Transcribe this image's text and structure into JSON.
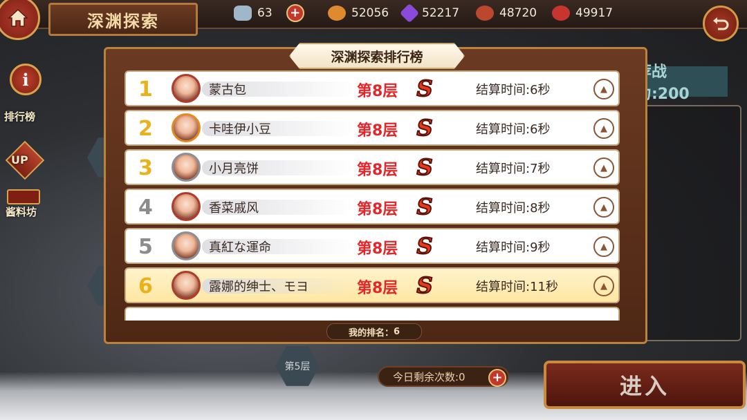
{
  "header": {
    "title": "深渊探索",
    "resources": [
      {
        "icon": "crystal-icon",
        "value": "63",
        "color": "#9fb7c9"
      },
      {
        "icon": "potion-icon",
        "value": "52056",
        "color": "#e08a2f"
      },
      {
        "icon": "gem-icon",
        "value": "52217",
        "color": "#8a4bd8"
      },
      {
        "icon": "meat-icon",
        "value": "48720",
        "color": "#b9482e"
      },
      {
        "icon": "pot-icon",
        "value": "49917",
        "color": "#c7362e"
      }
    ]
  },
  "left_menu": {
    "info": "i",
    "ranking": "排行榜",
    "up": "UP",
    "materials": "酱料坊"
  },
  "right": {
    "power": "荐战力:200",
    "remaining": "今日剩余次数:0",
    "enter": "进入"
  },
  "map": {
    "floor5": "第5层",
    "floor_partial": "第"
  },
  "leaderboard": {
    "title": "深渊探索排行榜",
    "my_rank_label": "我的排名：",
    "my_rank_value": "6",
    "rows": [
      {
        "rank": "1",
        "name": "蒙古包",
        "floor": "第8层",
        "grade": "S",
        "time": "结算时间:6秒",
        "rank_color": "#e8b21d",
        "avatar_border": "#b23a2a"
      },
      {
        "rank": "2",
        "name": "卡哇伊小豆",
        "floor": "第8层",
        "grade": "S",
        "time": "结算时间:6秒",
        "rank_color": "#e8b21d",
        "avatar_border": "#e38a1e"
      },
      {
        "rank": "3",
        "name": "小月亮饼",
        "floor": "第8层",
        "grade": "S",
        "time": "结算时间:7秒",
        "rank_color": "#e8b21d",
        "avatar_border": "#8b8f96"
      },
      {
        "rank": "4",
        "name": "香菜戚风",
        "floor": "第8层",
        "grade": "S",
        "time": "结算时间:8秒",
        "rank_color": "#8c8c8c",
        "avatar_border": "#b23a2a"
      },
      {
        "rank": "5",
        "name": "真紅な運命",
        "floor": "第8层",
        "grade": "S",
        "time": "结算时间:9秒",
        "rank_color": "#8c8c8c",
        "avatar_border": "#8b8f96"
      },
      {
        "rank": "6",
        "name": "露娜的绅士、モヨ",
        "floor": "第8层",
        "grade": "S",
        "time": "结算时间:11秒",
        "rank_color": "#e8b21d",
        "avatar_border": "#b23a2a",
        "is_me": true
      }
    ]
  }
}
